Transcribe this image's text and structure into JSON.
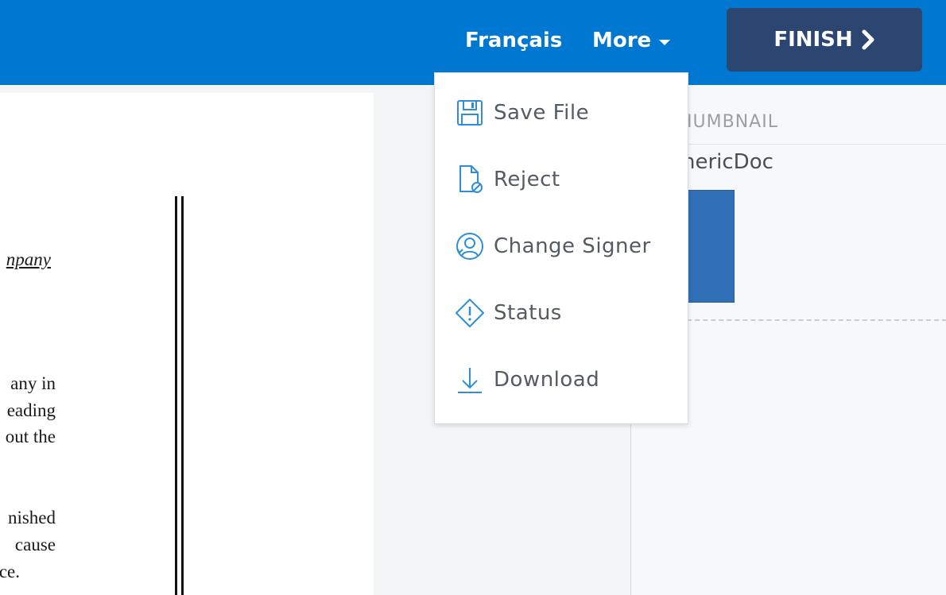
{
  "header": {
    "language_label": "Français",
    "more_label": "More",
    "finish_label": "FINISH"
  },
  "menu": {
    "items": [
      {
        "label": "Save File",
        "icon": "save-file-icon"
      },
      {
        "label": "Reject",
        "icon": "reject-document-icon"
      },
      {
        "label": "Change Signer",
        "icon": "change-signer-icon"
      },
      {
        "label": "Status",
        "icon": "status-warning-icon"
      },
      {
        "label": "Download",
        "icon": "download-icon"
      }
    ]
  },
  "thumbnail_panel": {
    "heading": "HUMBNAIL",
    "document_name": "enericDoc"
  },
  "document": {
    "lines": [
      "npany",
      "any in",
      "eading",
      "out the",
      "nished",
      "cause",
      "ce."
    ]
  },
  "colors": {
    "header_bg": "#0078d2",
    "finish_bg": "#2c4672",
    "icon_blue": "#2e8fd8",
    "thumbnail_fill": "#2e6fb5"
  }
}
